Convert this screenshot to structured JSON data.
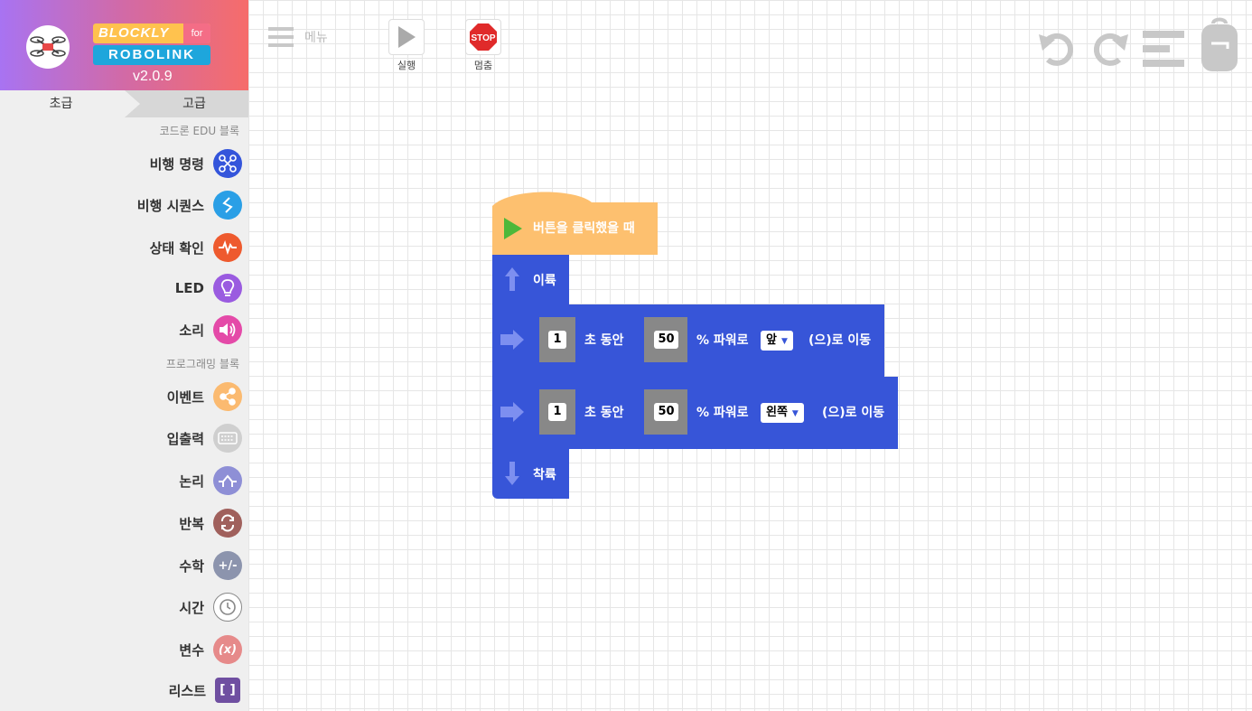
{
  "app": {
    "logo_top": "BLOCKLY",
    "logo_for": "for",
    "logo_bottom": "ROBOLINK",
    "version": "v2.0.9"
  },
  "level_tabs": {
    "basic": "초급",
    "advanced": "고급"
  },
  "sections": {
    "codrone": "코드론 EDU 블록",
    "programming": "프로그래밍 블록"
  },
  "categories": [
    {
      "label": "비행 명령",
      "icon": "drone-icon",
      "color": "#3455db"
    },
    {
      "label": "비행 시퀀스",
      "icon": "sequence-icon",
      "color": "#2a9fe6"
    },
    {
      "label": "상태 확인",
      "icon": "pulse-icon",
      "color": "#ee5a2e"
    },
    {
      "label": "LED",
      "icon": "bulb-icon",
      "color": "#9a5be0"
    },
    {
      "label": "소리",
      "icon": "speaker-icon",
      "color": "#e44aa8"
    },
    {
      "label": "이벤트",
      "icon": "share-icon",
      "color": "#fbba70"
    },
    {
      "label": "입출력",
      "icon": "keyboard-icon",
      "color": "#cfcfcf"
    },
    {
      "label": "논리",
      "icon": "logic-icon",
      "color": "#8e8fd6"
    },
    {
      "label": "반복",
      "icon": "loop-icon",
      "color": "#a0605c"
    },
    {
      "label": "수학",
      "icon": "math-icon",
      "color": "#8c94ad"
    },
    {
      "label": "시간",
      "icon": "clock-icon",
      "color": "#ffffff"
    },
    {
      "label": "변수",
      "icon": "variable-icon",
      "color": "#e68a8a"
    },
    {
      "label": "리스트",
      "icon": "list-icon",
      "color": "#6f4fa1"
    }
  ],
  "toolbar": {
    "menu": "메뉴",
    "run": "실행",
    "stop": "멈춤",
    "stop_sign": "STOP"
  },
  "blocks": {
    "event": "버튼을 클릭했을 때",
    "takeoff": "이륙",
    "move1": {
      "seconds": "1",
      "sec_label": "초 동안",
      "power": "50",
      "power_label": "% 파워로",
      "direction": "앞",
      "suffix": "(으)로 이동"
    },
    "move2": {
      "seconds": "1",
      "sec_label": "초 동안",
      "power": "50",
      "power_label": "% 파워로",
      "direction": "왼쪽",
      "suffix": "(으)로 이동"
    },
    "land": "착륙"
  }
}
